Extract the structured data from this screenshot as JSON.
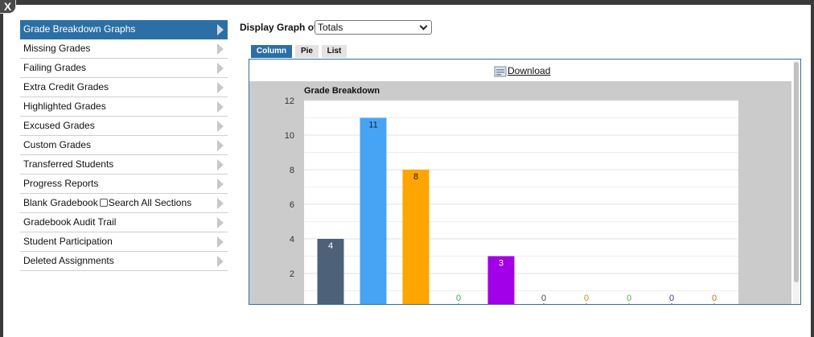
{
  "window": {
    "close_label": "X"
  },
  "sidebar": {
    "items": [
      {
        "label": "Grade Breakdown Graphs",
        "active": true
      },
      {
        "label": "Missing Grades"
      },
      {
        "label": "Failing Grades"
      },
      {
        "label": "Extra Credit Grades"
      },
      {
        "label": "Highlighted Grades"
      },
      {
        "label": "Excused Grades"
      },
      {
        "label": "Custom Grades"
      },
      {
        "label": "Transferred Students"
      },
      {
        "label": "Progress Reports"
      },
      {
        "label": "Blank Gradebook",
        "checkbox_label": "Search All Sections",
        "checkbox_checked": false
      },
      {
        "label": "Gradebook Audit Trail"
      },
      {
        "label": "Student Participation"
      },
      {
        "label": "Deleted Assignments"
      }
    ]
  },
  "display": {
    "label": "Display Graph of",
    "selected": "Totals"
  },
  "tabs": [
    {
      "label": "Column",
      "active": true
    },
    {
      "label": "Pie"
    },
    {
      "label": "List"
    }
  ],
  "download": {
    "label": "Download",
    "icon": "download-icon"
  },
  "colors": {
    "accent": "#2c6fa6",
    "chart_bg": "#cbcbcb"
  },
  "chart_data": {
    "type": "bar",
    "title": "Grade Breakdown",
    "xlabel": "",
    "ylabel": "",
    "ylim": [
      0,
      12
    ],
    "yticks": [
      2,
      4,
      6,
      8,
      10,
      12
    ],
    "grid": true,
    "values": [
      4,
      11,
      8,
      0,
      3,
      0,
      0,
      0,
      0,
      0
    ],
    "colors": [
      "#4d6178",
      "#47a4f5",
      "#ffa500",
      "#3cb371",
      "#a200e6",
      "#5a3a3a",
      "#c98a1a",
      "#6cc24a",
      "#3a3aa0",
      "#d2691e"
    ],
    "label_colors": [
      "#ffffff",
      "#222222",
      "#222222",
      "#2eaa5a",
      "#ffffff",
      "#5a3a3a",
      "#c98a1a",
      "#55b03a",
      "#3a3aa0",
      "#d2691e"
    ]
  }
}
